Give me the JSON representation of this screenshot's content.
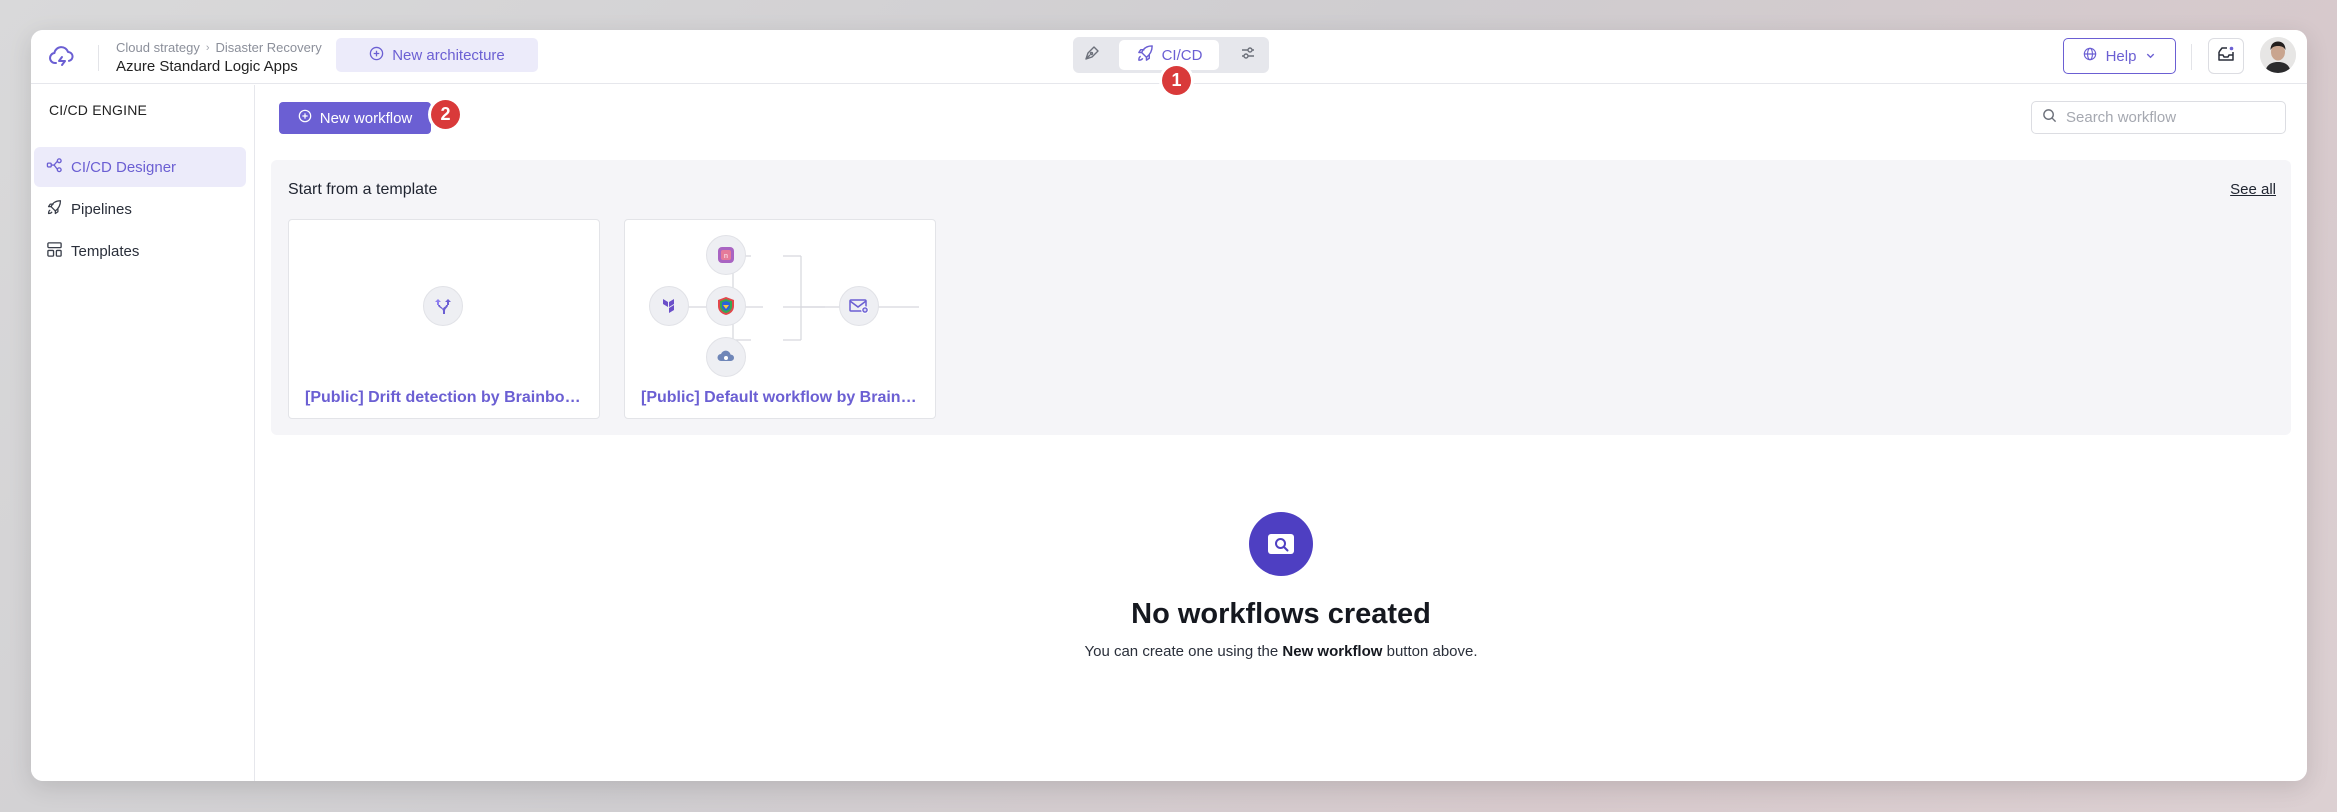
{
  "header": {
    "breadcrumb": [
      "Cloud strategy",
      "Disaster Recovery"
    ],
    "app_title": "Azure Standard Logic Apps",
    "new_architecture_label": "New architecture",
    "mode_switch": {
      "active_label": "CI/CD"
    },
    "help_label": "Help"
  },
  "annotations": {
    "badge_1": "1",
    "badge_2": "2"
  },
  "sidebar": {
    "title": "CI/CD ENGINE",
    "items": [
      {
        "label": "CI/CD Designer",
        "icon": "workflow-icon",
        "active": true
      },
      {
        "label": "Pipelines",
        "icon": "rocket-icon",
        "active": false
      },
      {
        "label": "Templates",
        "icon": "templates-icon",
        "active": false
      }
    ]
  },
  "main": {
    "new_workflow_label": "New workflow",
    "search": {
      "placeholder": "Search workflow",
      "value": ""
    },
    "templates": {
      "title": "Start from a template",
      "see_all": "See all",
      "cards": [
        {
          "label": "[Public] Drift detection by Brainboard"
        },
        {
          "label": "[Public] Default workflow by Brainboard"
        }
      ]
    },
    "empty_state": {
      "title": "No workflows created",
      "sub_prefix": "You can create one using the ",
      "sub_bold": "New workflow",
      "sub_suffix": " button above."
    }
  },
  "colors": {
    "accent": "#6b5fd3",
    "accent_light": "#ecebfa",
    "badge": "#d93a3a",
    "empty_icon_bg": "#4e3fc2"
  }
}
